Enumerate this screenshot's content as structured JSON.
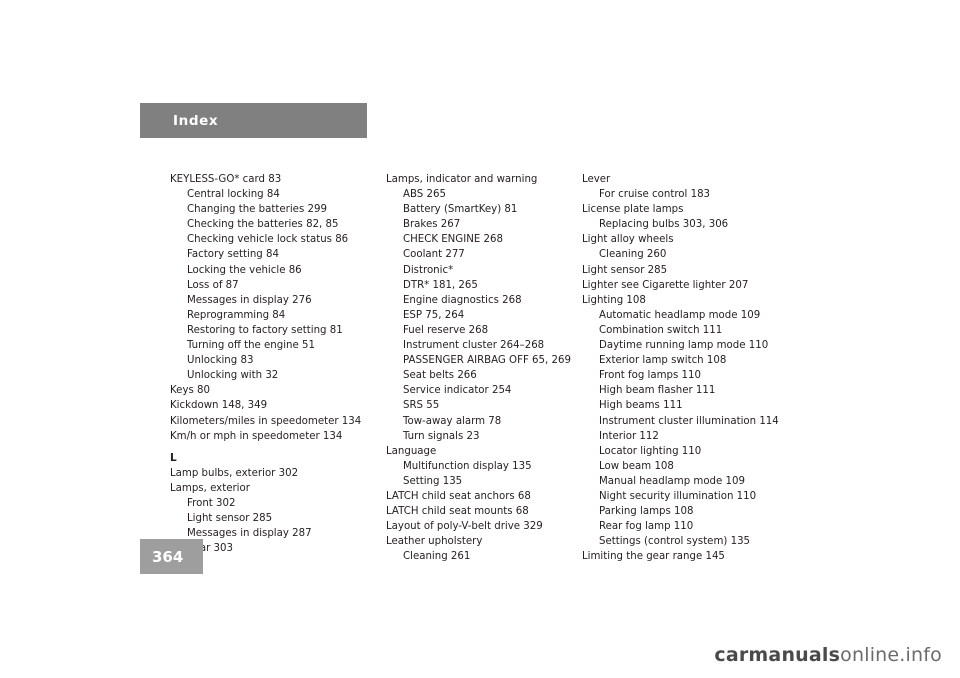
{
  "header": {
    "section_label": "Index"
  },
  "footer": {
    "page_number": "364",
    "watermark_prefix": "carmanuals",
    "watermark_suffix": "online.info"
  },
  "columns": [
    {
      "name": "column-1",
      "entries": [
        {
          "level": 0,
          "text": "KEYLESS-GO* card    83"
        },
        {
          "level": 1,
          "text": "Central locking    84"
        },
        {
          "level": 1,
          "text": "Changing the batteries    299"
        },
        {
          "level": 1,
          "text": "Checking the batteries    82, 85"
        },
        {
          "level": 1,
          "text": "Checking vehicle lock status    86"
        },
        {
          "level": 1,
          "text": "Factory setting    84"
        },
        {
          "level": 1,
          "text": "Locking the vehicle    86"
        },
        {
          "level": 1,
          "text": "Loss of    87"
        },
        {
          "level": 1,
          "text": "Messages in display    276"
        },
        {
          "level": 1,
          "text": "Reprogramming    84"
        },
        {
          "level": 1,
          "text": "Restoring to factory setting    81"
        },
        {
          "level": 1,
          "text": "Turning off the engine    51"
        },
        {
          "level": 1,
          "text": "Unlocking    83"
        },
        {
          "level": 1,
          "text": "Unlocking with    32"
        },
        {
          "level": 0,
          "text": "Keys    80"
        },
        {
          "level": 0,
          "text": "Kickdown    148, 349"
        },
        {
          "level": 0,
          "text": "Kilometers/miles in speedometer    134"
        },
        {
          "level": 0,
          "text": "Km/h or mph in speedometer    134"
        },
        {
          "level": -1,
          "text": "L"
        },
        {
          "level": 0,
          "text": "Lamp bulbs, exterior    302"
        },
        {
          "level": 0,
          "text": "Lamps, exterior"
        },
        {
          "level": 1,
          "text": "Front    302"
        },
        {
          "level": 1,
          "text": "Light sensor    285"
        },
        {
          "level": 1,
          "text": "Messages in display    287"
        },
        {
          "level": 1,
          "text": "Rear    303"
        }
      ]
    },
    {
      "name": "column-2",
      "entries": [
        {
          "level": 0,
          "text": "Lamps, indicator and warning"
        },
        {
          "level": 1,
          "text": "ABS    265"
        },
        {
          "level": 1,
          "text": "Battery (SmartKey)    81"
        },
        {
          "level": 1,
          "text": "Brakes    267"
        },
        {
          "level": 1,
          "text": "CHECK ENGINE    268"
        },
        {
          "level": 1,
          "text": "Coolant    277"
        },
        {
          "level": 1,
          "text": "Distronic*"
        },
        {
          "level": 1,
          "text": "DTR*    181, 265"
        },
        {
          "level": 1,
          "text": "Engine diagnostics    268"
        },
        {
          "level": 1,
          "text": "ESP    75, 264"
        },
        {
          "level": 1,
          "text": "Fuel reserve    268"
        },
        {
          "level": 1,
          "text": "Instrument cluster    264–268"
        },
        {
          "level": 1,
          "text": "PASSENGER AIRBAG OFF    65, 269"
        },
        {
          "level": 1,
          "text": "Seat belts    266"
        },
        {
          "level": 1,
          "text": "Service indicator    254"
        },
        {
          "level": 1,
          "text": "SRS    55"
        },
        {
          "level": 1,
          "text": "Tow-away alarm    78"
        },
        {
          "level": 1,
          "text": "Turn signals    23"
        },
        {
          "level": 0,
          "text": "Language"
        },
        {
          "level": 1,
          "text": "Multifunction display    135"
        },
        {
          "level": 1,
          "text": "Setting    135"
        },
        {
          "level": 0,
          "text": "LATCH child seat anchors    68"
        },
        {
          "level": 0,
          "text": "LATCH child seat mounts    68"
        },
        {
          "level": 0,
          "text": "Layout of poly-V-belt drive    329"
        },
        {
          "level": 0,
          "text": "Leather upholstery"
        },
        {
          "level": 1,
          "text": "Cleaning    261"
        }
      ]
    },
    {
      "name": "column-3",
      "entries": [
        {
          "level": 0,
          "text": "Lever"
        },
        {
          "level": 1,
          "text": "For cruise control    183"
        },
        {
          "level": 0,
          "text": "License plate lamps"
        },
        {
          "level": 1,
          "text": "Replacing bulbs    303, 306"
        },
        {
          "level": 0,
          "text": "Light alloy wheels"
        },
        {
          "level": 1,
          "text": "Cleaning    260"
        },
        {
          "level": 0,
          "text": "Light sensor    285"
        },
        {
          "level": 0,
          "text": "Lighter see Cigarette lighter    207"
        },
        {
          "level": 0,
          "text": "Lighting    108"
        },
        {
          "level": 1,
          "text": "Automatic headlamp mode    109"
        },
        {
          "level": 1,
          "text": "Combination switch    111"
        },
        {
          "level": 1,
          "text": "Daytime running lamp mode    110"
        },
        {
          "level": 1,
          "text": "Exterior lamp switch    108"
        },
        {
          "level": 1,
          "text": "Front fog lamps    110"
        },
        {
          "level": 1,
          "text": "High beam flasher    111"
        },
        {
          "level": 1,
          "text": "High beams    111"
        },
        {
          "level": 1,
          "text": "Instrument cluster illumination    114"
        },
        {
          "level": 1,
          "text": "Interior    112"
        },
        {
          "level": 1,
          "text": "Locator lighting    110"
        },
        {
          "level": 1,
          "text": "Low beam    108"
        },
        {
          "level": 1,
          "text": "Manual headlamp mode    109"
        },
        {
          "level": 1,
          "text": "Night security illumination    110"
        },
        {
          "level": 1,
          "text": "Parking lamps    108"
        },
        {
          "level": 1,
          "text": "Rear fog lamp    110"
        },
        {
          "level": 1,
          "text": "Settings (control system)    135"
        },
        {
          "level": 0,
          "text": "Limiting the gear range    145"
        }
      ]
    }
  ]
}
